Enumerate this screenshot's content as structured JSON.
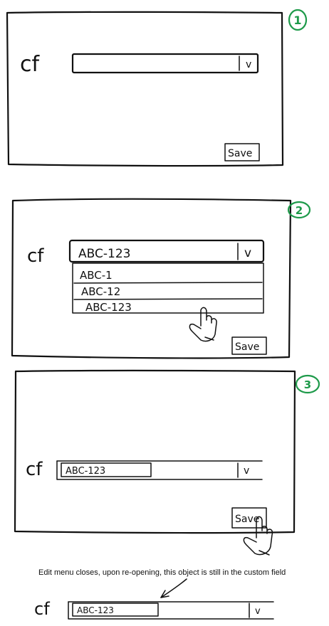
{
  "steps": [
    {
      "number": "1",
      "field_label": "cf",
      "dropdown_value": "",
      "dropdown_arrow": "v",
      "save_label": "Save"
    },
    {
      "number": "2",
      "field_label": "cf",
      "dropdown_value": "ABC-123",
      "dropdown_arrow": "v",
      "options": [
        "ABC-1",
        "ABC-12",
        "ABC-123"
      ],
      "save_label": "Save",
      "pointer_icon": "hand-pointer-icon"
    },
    {
      "number": "3",
      "field_label": "cf",
      "dropdown_value": "ABC-123",
      "dropdown_arrow": "v",
      "save_label": "Save",
      "pointer_icon": "hand-pointer-icon"
    }
  ],
  "note": {
    "text": "Edit menu closes, upon re-opening, this object is still in the custom field",
    "field_label": "cf",
    "dropdown_value": "ABC-123",
    "dropdown_arrow": "v"
  },
  "colors": {
    "ink": "#111111",
    "step_marker": "#1e9a4a"
  }
}
